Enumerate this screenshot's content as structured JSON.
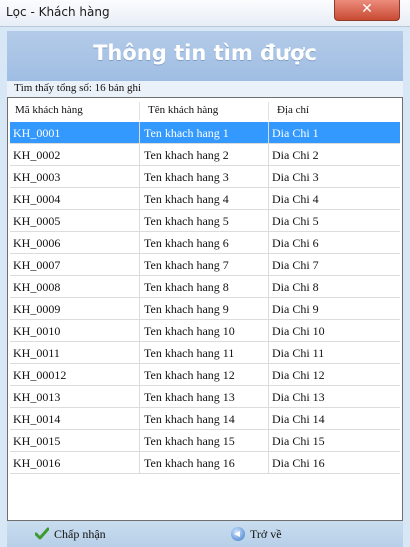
{
  "window": {
    "title": "Lọc - Khách hàng",
    "close_icon": "close-icon"
  },
  "header": {
    "title": "Thông tin tìm được"
  },
  "summary": {
    "text": "Tìm thấy tổng số: 16 bản ghi"
  },
  "table": {
    "columns": [
      "Mã khách hàng",
      "Tên khách hàng",
      "Địa chỉ"
    ],
    "selected_row": 0,
    "rows": [
      [
        "KH_0001",
        "Ten khach hang 1",
        "Dia Chi 1"
      ],
      [
        "KH_0002",
        "Ten khach hang 2",
        "Dia Chi 2"
      ],
      [
        "KH_0003",
        "Ten khach hang 3",
        "Dia Chi 3"
      ],
      [
        "KH_0004",
        "Ten khach hang 4",
        "Dia Chi 4"
      ],
      [
        "KH_0005",
        "Ten khach hang 5",
        "Dia Chi 5"
      ],
      [
        "KH_0006",
        "Ten khach hang 6",
        "Dia Chi 6"
      ],
      [
        "KH_0007",
        "Ten khach hang 7",
        "Dia Chi 7"
      ],
      [
        "KH_0008",
        "Ten khach hang 8",
        "Dia Chi 8"
      ],
      [
        "KH_0009",
        "Ten khach hang 9",
        "Dia Chi 9"
      ],
      [
        "KH_0010",
        "Ten khach hang 10",
        "Dia Chi 10"
      ],
      [
        "KH_0011",
        "Ten khach hang 11",
        "Dia Chi 11"
      ],
      [
        "KH_00012",
        "Ten khach hang 12",
        "Dia Chi 12"
      ],
      [
        "KH_0013",
        "Ten khach hang 13",
        "Dia Chi 13"
      ],
      [
        "KH_0014",
        "Ten khach hang 14",
        "Dia Chi 14"
      ],
      [
        "KH_0015",
        "Ten khach hang 15",
        "Dia Chi 15"
      ],
      [
        "KH_0016",
        "Ten khach hang 16",
        "Dia Chi 16"
      ]
    ]
  },
  "footer": {
    "accept_label": "Chấp nhận",
    "back_label": "Trở về"
  },
  "colors": {
    "selection": "#3399ff",
    "header_band": "#a9c4e6",
    "close_button": "#c84a33"
  }
}
